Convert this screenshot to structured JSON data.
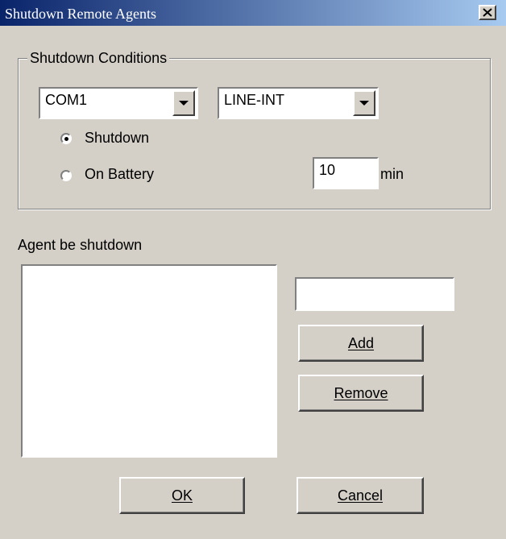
{
  "window": {
    "title": "Shutdown Remote Agents",
    "close_icon": "close-icon"
  },
  "shutdown_conditions": {
    "legend": "Shutdown Conditions",
    "port_select": {
      "value": "COM1",
      "icon": "chevron-down-icon"
    },
    "ups_type_select": {
      "value": "LINE-INT",
      "icon": "chevron-down-icon"
    },
    "options": [
      {
        "label": "Shutdown",
        "selected": true
      },
      {
        "label": "On Battery",
        "selected": false
      }
    ],
    "delay": {
      "value": "10",
      "unit": "min"
    }
  },
  "agents": {
    "label": "Agent be shutdown",
    "list_items": [],
    "new_agent_value": "",
    "add_label": "Add",
    "remove_label": "Remove"
  },
  "footer": {
    "ok_label": "OK",
    "cancel_label": "Cancel"
  }
}
